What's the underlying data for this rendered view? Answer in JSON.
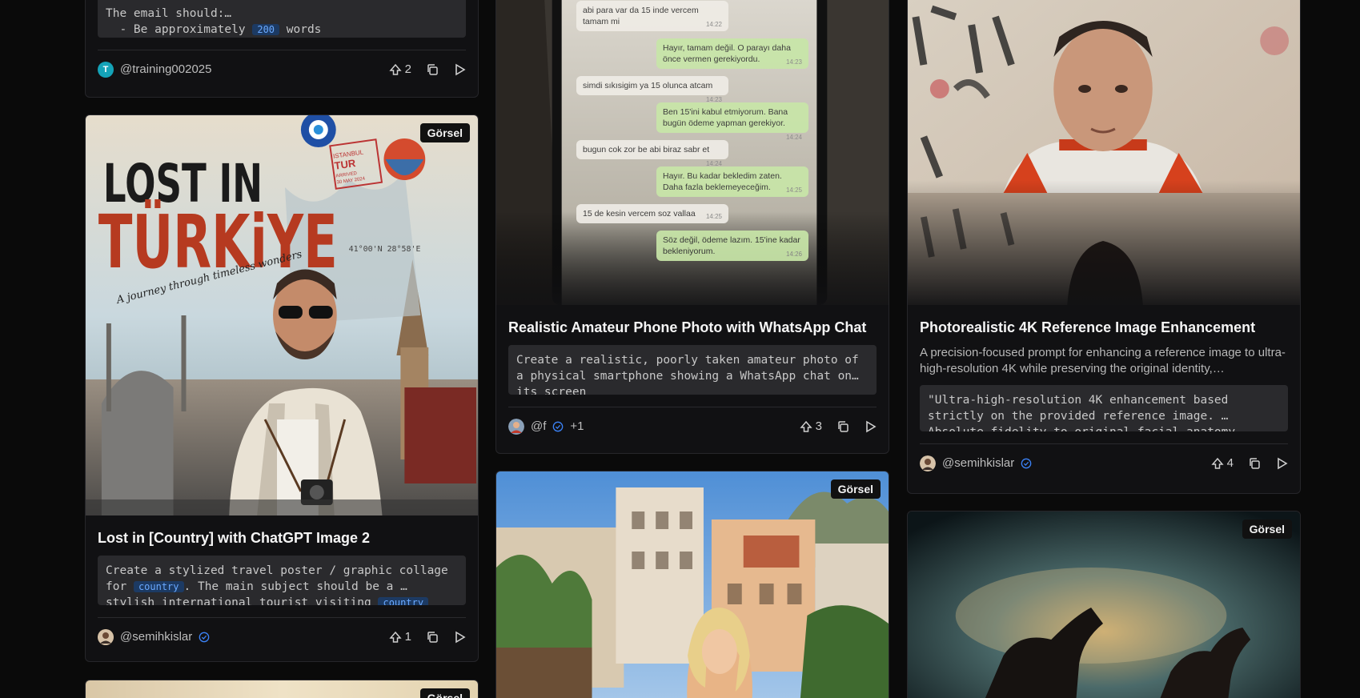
{
  "badge_label": "Görsel",
  "cards": {
    "email": {
      "code_lines": [
        "The email should:…",
        "- Be approximately",
        "words"
      ],
      "code_var": "200",
      "author": "@training002025",
      "avatar_letter": "T",
      "upvotes": "2"
    },
    "turkiye": {
      "poster_title_1": "LOST IN",
      "poster_title_2": "TÜRKiYE",
      "poster_tagline": "A journey through timeless wonders",
      "stamp_1": "ISTANBUL",
      "stamp_2": "TUR",
      "stamp_3": "ARRIVED",
      "stamp_4": "30 MAY 2024",
      "coords": "41°00'N 28°58'E",
      "title": "Lost in [Country] with ChatGPT Image 2",
      "code_part1": "Create a stylized travel poster / graphic collage for",
      "code_var": "country",
      "code_part2": ". The main subject should be a …",
      "code_part3": "stylish international tourist visiting",
      "author": "@semihkislar",
      "upvotes": "1"
    },
    "whatsapp": {
      "chat": [
        {
          "side": "in",
          "text": "abi para var da 15 inde vercem tamam mi",
          "time": "14:22"
        },
        {
          "side": "out",
          "text": "Hayır, tamam değil. O parayı daha önce vermen gerekiyordu.",
          "time": "14:23"
        },
        {
          "side": "in",
          "text": "simdi sıkısigim ya 15 olunca atcam",
          "time": "14:23"
        },
        {
          "side": "out",
          "text": "Ben 15'ini kabul etmiyorum. Bana bugün ödeme yapman gerekiyor.",
          "time": "14:24"
        },
        {
          "side": "in",
          "text": "bugun cok zor be abi biraz sabr et",
          "time": "14:24"
        },
        {
          "side": "out",
          "text": "Hayır. Bu kadar bekledim zaten. Daha fazla beklemeyeceğim.",
          "time": "14:25"
        },
        {
          "side": "in",
          "text": "15 de kesin vercem soz vallaa",
          "time": "14:25"
        },
        {
          "side": "out",
          "text": "Söz değil, ödeme lazım. 15'ine kadar bekleniyorum.",
          "time": "14:26"
        }
      ],
      "title": "Realistic Amateur Phone Photo with WhatsApp Chat",
      "code": "Create a realistic, poorly taken amateur photo of a physical smartphone showing a WhatsApp chat on… its screen",
      "author": "@f",
      "extra_authors": "+1",
      "upvotes": "3"
    },
    "enhance": {
      "title": "Photorealistic 4K Reference Image Enhancement",
      "desc": "A precision-focused prompt for enhancing a reference image to ultra-high-resolution 4K while preserving the original identity,…",
      "code": "\"Ultra-high-resolution 4K enhancement based strictly on the provided reference image. … Absolute fidelity to original facial anatomy",
      "author": "@semihkislar",
      "upvotes": "4"
    }
  },
  "colors": {
    "accent_blue": "#3b82f6",
    "card_bg": "#111113",
    "page_bg": "#0a0a0a"
  }
}
